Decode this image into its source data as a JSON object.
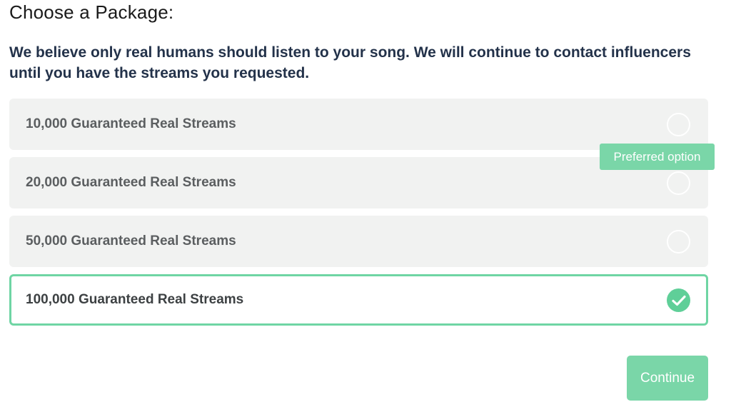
{
  "title": "Choose a Package:",
  "subtitle": "We believe only real humans should listen to your song. We will continue to contact influencers until you have the streams you requested.",
  "packages": [
    {
      "label": "10,000 Guaranteed Real Streams",
      "selected": false
    },
    {
      "label": "20,000 Guaranteed Real Streams",
      "selected": false
    },
    {
      "label": "50,000 Guaranteed Real Streams",
      "selected": false
    },
    {
      "label": "100,000 Guaranteed Real Streams",
      "selected": true
    }
  ],
  "preferred_badge": "Preferred option",
  "continue_label": "Continue",
  "colors": {
    "accent": "#7ad6a8",
    "selected_border": "#6fd5a4",
    "option_bg": "#f1f2f1",
    "heading": "#23324a"
  },
  "icons": {
    "selected": "checkmark-icon",
    "unselected": "radio-empty-icon"
  }
}
